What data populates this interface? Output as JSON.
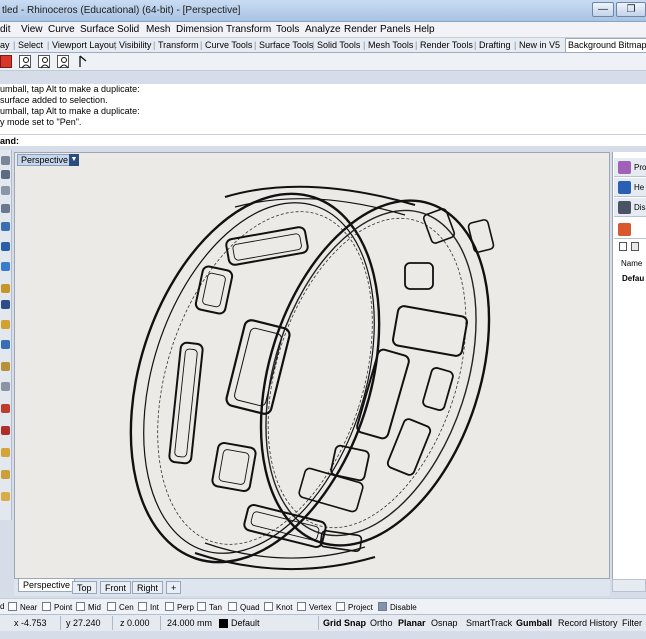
{
  "window": {
    "title": "tled - Rhinoceros (Educational) (64-bit) - [Perspective]",
    "minimize_label": "—",
    "maximize_label": "❐"
  },
  "menu": [
    "dit",
    "View",
    "Curve",
    "Surface",
    "Solid",
    "Mesh",
    "Dimension",
    "Transform",
    "Tools",
    "Analyze",
    "Render",
    "Panels",
    "Help"
  ],
  "toolbar_tabs": [
    "ay",
    "Select",
    "Viewport Layout",
    "Visibility",
    "Transform",
    "Curve Tools",
    "Surface Tools",
    "Solid Tools",
    "Mesh Tools",
    "Render Tools",
    "Drafting",
    "New in V5",
    "Background Bitmap"
  ],
  "toolbar_icons": [
    "render-icon",
    "person-icon",
    "person-icon",
    "person-icon",
    "cursor-icon"
  ],
  "command_history": [
    "umball, tap Alt to make a duplicate:",
    "surface added to selection.",
    "umball, tap Alt to make a duplicate:",
    "y mode set to \"Pen\"."
  ],
  "command_prompt": "and:",
  "viewport": {
    "label": "Perspective"
  },
  "view_tabs": [
    "Perspective",
    "Top",
    "Front",
    "Right",
    "+"
  ],
  "right_panel": {
    "tabs": [
      {
        "label": "Pro",
        "icon": "properties-icon"
      },
      {
        "label": "He",
        "icon": "help-icon"
      },
      {
        "label": "Dis",
        "icon": "display-icon"
      }
    ],
    "column_header": "Name",
    "row_value": "Defau"
  },
  "osnap": [
    {
      "label": "d",
      "checked": false
    },
    {
      "label": "Near",
      "checked": false
    },
    {
      "label": "Point",
      "checked": false
    },
    {
      "label": "Mid",
      "checked": false
    },
    {
      "label": "Cen",
      "checked": false
    },
    {
      "label": "Int",
      "checked": false
    },
    {
      "label": "Perp",
      "checked": false
    },
    {
      "label": "Tan",
      "checked": false
    },
    {
      "label": "Quad",
      "checked": false
    },
    {
      "label": "Knot",
      "checked": false
    },
    {
      "label": "Vertex",
      "checked": false
    },
    {
      "label": "Project",
      "checked": false
    },
    {
      "label": "Disable",
      "checked": true
    }
  ],
  "status": {
    "x": "x -4.753",
    "y": "y 27.240",
    "z": "z 0.000",
    "unit": "24.000 mm",
    "layer": "Default",
    "buttons": [
      "Grid Snap",
      "Ortho",
      "Planar",
      "Osnap",
      "SmartTrack",
      "Gumball",
      "Record History",
      "Filter"
    ],
    "bold": [
      "Grid Snap",
      "Planar",
      "Gumball"
    ]
  }
}
